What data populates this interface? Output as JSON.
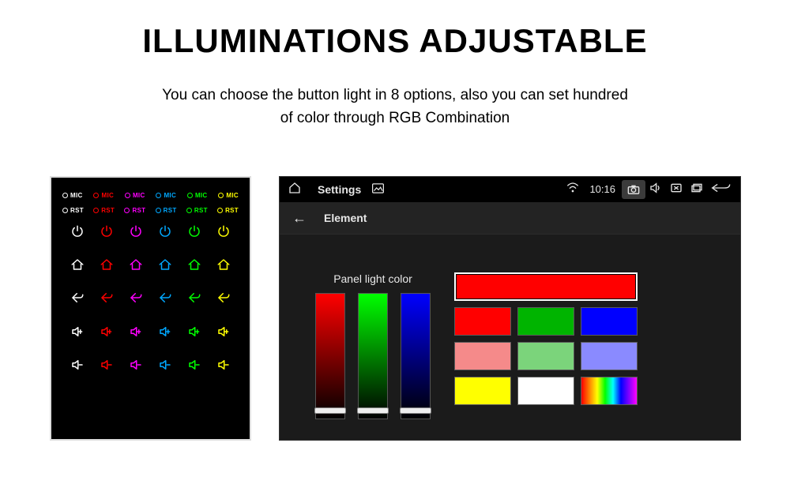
{
  "page": {
    "title": "ILLUMINATIONS ADJUSTABLE",
    "subtitle_line1": "You can choose the button light in 8 options, also you can set hundred",
    "subtitle_line2": "of color through RGB Combination"
  },
  "button_panel": {
    "mic_label": "MIC",
    "rst_label": "RST",
    "colors": [
      "#ffffff",
      "#ff0000",
      "#ff00ff",
      "#00a8ff",
      "#00ff00",
      "#ffff00"
    ],
    "icon_rows": [
      "power",
      "home",
      "back",
      "vol-up",
      "vol-down"
    ]
  },
  "settings": {
    "statusbar": {
      "title": "Settings",
      "clock": "10:16"
    },
    "subbar": {
      "title": "Element"
    },
    "sliders_label": "Panel light color",
    "sliders": {
      "r_max": "#ff0000",
      "g_max": "#00ff00",
      "b_max": "#0000ff"
    },
    "swatches": {
      "selected_index": 0,
      "colors": [
        "#ff0000",
        "#ff0000",
        "#00b400",
        "#0000ff",
        "#f58a8a",
        "#7bd47b",
        "#8a8aff",
        "#ffff00",
        "#ffffff",
        "rainbow"
      ]
    }
  }
}
